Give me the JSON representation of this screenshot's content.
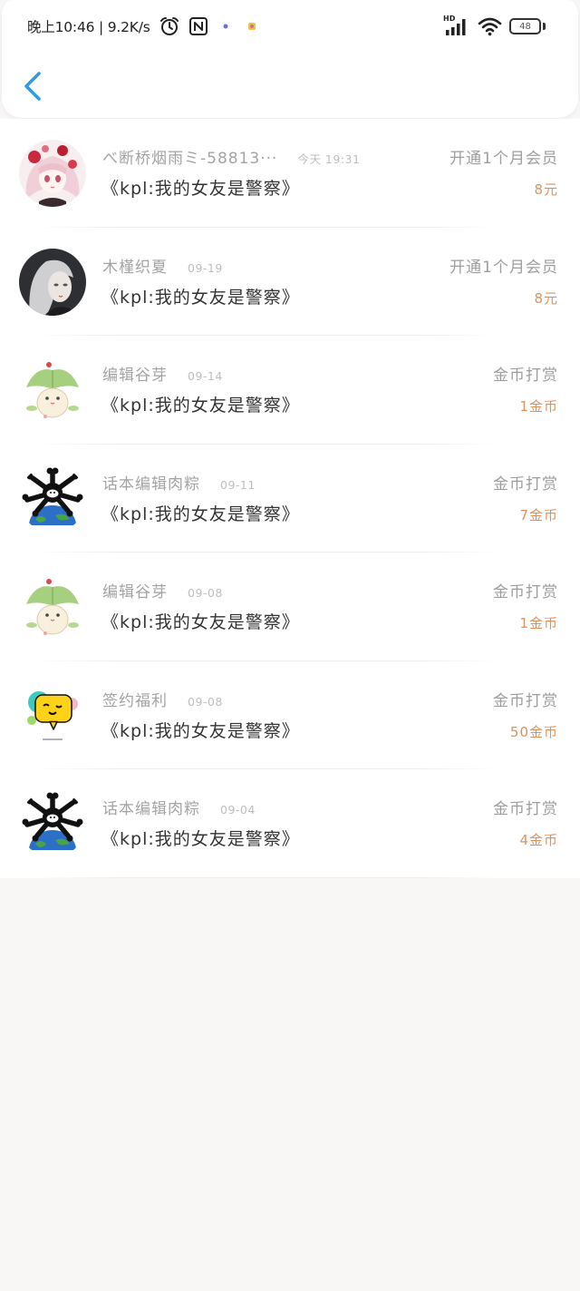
{
  "status_bar": {
    "time_speed": "晚上10:46 | 9.2K/s",
    "left_icons": [
      "alarm-icon",
      "nfc-icon",
      "app-notification-icon",
      "app-notification-icon"
    ],
    "signal_label": "HD",
    "battery_level": "48"
  },
  "header": {
    "back_icon": "chevron-left-icon"
  },
  "colors": {
    "accent": "#2f9be6",
    "amount": "#e0915a",
    "page_bg": "#f9f6f6"
  },
  "records": [
    {
      "name": "べ断桥烟雨ミ-58813···",
      "time": "今天 19:31",
      "type": "开通1个月会员",
      "book": "《kpl:我的女友是警察》",
      "amount": "8元",
      "avatar": "anime-girl-avatar"
    },
    {
      "name": "木槿织夏",
      "time": "09-19",
      "type": "开通1个月会员",
      "book": "《kpl:我的女友是警察》",
      "amount": "8元",
      "avatar": "dark-anime-avatar"
    },
    {
      "name": "编辑谷芽",
      "time": "09-14",
      "type": "金币打赏",
      "book": "《kpl:我的女友是警察》",
      "amount": "1金币",
      "avatar": "leaf-bunny-avatar"
    },
    {
      "name": "话本编辑肉粽",
      "time": "09-11",
      "type": "金币打赏",
      "book": "《kpl:我的女友是警察》",
      "amount": "7金币",
      "avatar": "bones-earth-avatar"
    },
    {
      "name": "编辑谷芽",
      "time": "09-08",
      "type": "金币打赏",
      "book": "《kpl:我的女友是警察》",
      "amount": "1金币",
      "avatar": "leaf-bunny-avatar"
    },
    {
      "name": "签约福利",
      "time": "09-08",
      "type": "金币打赏",
      "book": "《kpl:我的女友是警察》",
      "amount": "50金币",
      "avatar": "chat-bubble-avatar"
    },
    {
      "name": "话本编辑肉粽",
      "time": "09-04",
      "type": "金币打赏",
      "book": "《kpl:我的女友是警察》",
      "amount": "4金币",
      "avatar": "bones-earth-avatar"
    }
  ]
}
